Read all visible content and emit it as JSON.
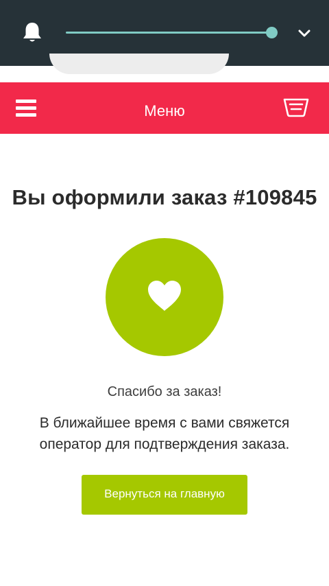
{
  "status_bar": {
    "brightness_level": 1.0,
    "icons": [
      "bell-icon",
      "chevron-down-icon"
    ],
    "background": "#263238",
    "accent": "#80cbc4"
  },
  "header": {
    "title": "Меню",
    "background": "#f2294a",
    "icons": [
      "hamburger-menu-icon",
      "cart-icon"
    ]
  },
  "main": {
    "order_title": "Вы оформили заказ #109845",
    "status_icon": "heart-icon",
    "accent": "#a5c800",
    "thanks": "Спасибо за заказ!",
    "info": "В ближайшее время с вами свяжется оператор для подтверждения заказа.",
    "button_label": "Вернуться на главную"
  }
}
